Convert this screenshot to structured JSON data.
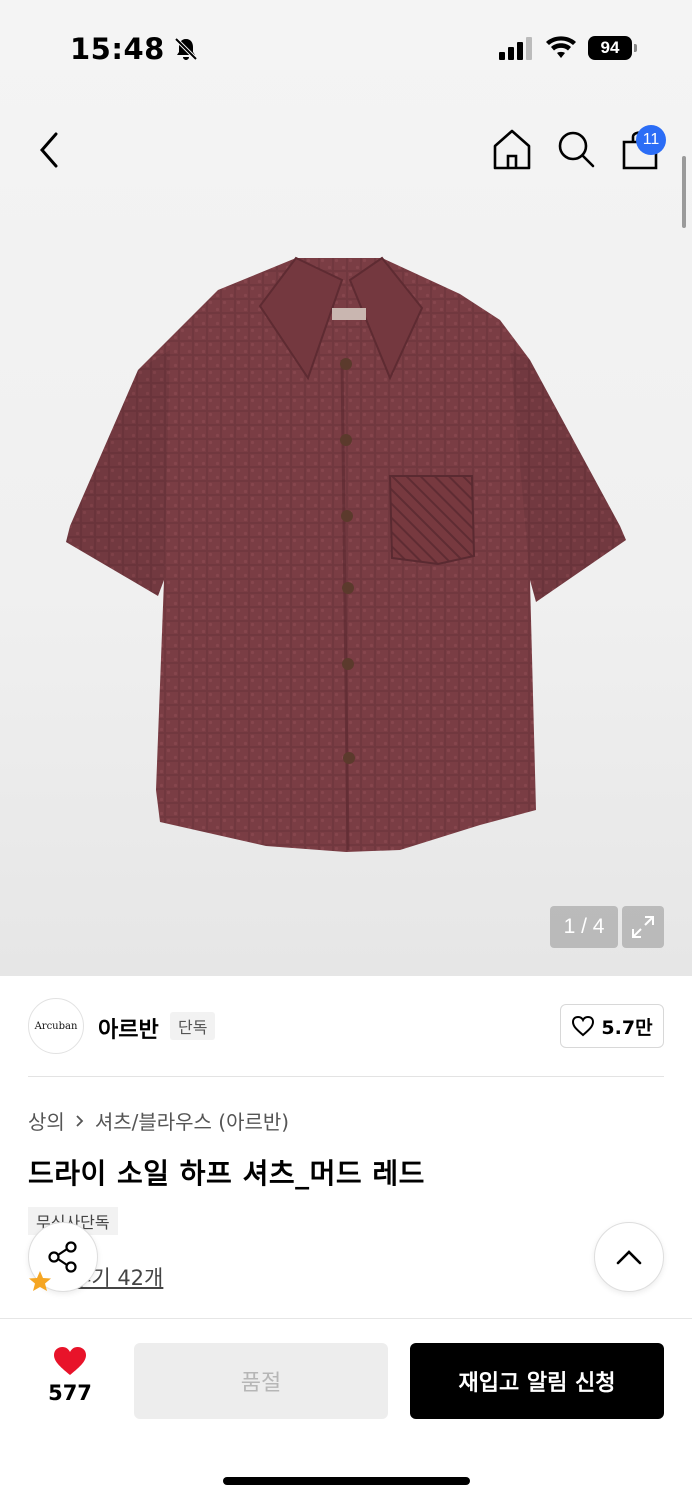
{
  "status_bar": {
    "time": "15:48",
    "battery": "94"
  },
  "nav": {
    "cart_count": "11"
  },
  "gallery": {
    "pager": "1 / 4"
  },
  "brand": {
    "logo_text": "Arcuban",
    "name": "아르반",
    "tag": "단독",
    "likes": "5.7만"
  },
  "product": {
    "breadcrumb_1": "상의",
    "breadcrumb_2": "셔츠/블라우스 (아르반)",
    "title": "드라이 소일 하프 셔츠_머드 레드",
    "badge": "무신사단독",
    "reviews": "후기 42개"
  },
  "bottom": {
    "wish_count": "577",
    "soldout_label": "품절",
    "restock_label": "재입고 알림 신청"
  },
  "colors": {
    "shirt": "#7a3d44",
    "badge_blue": "#2b6df6",
    "heart_red": "#e8132a",
    "star": "#f5a623"
  }
}
